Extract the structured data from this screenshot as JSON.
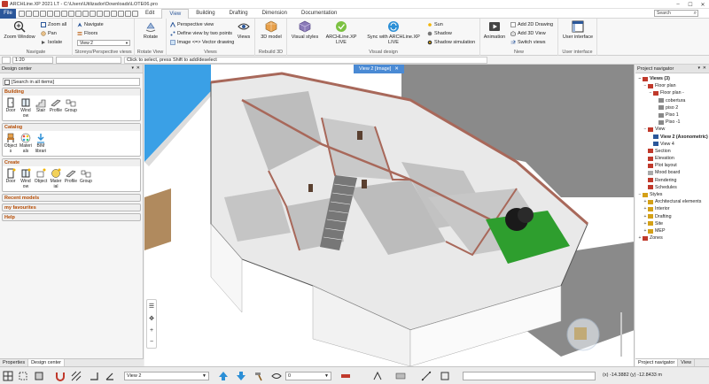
{
  "window": {
    "title": "ARCHLine.XP 2021  LT - C:\\Users\\Utilizador\\Downloads\\LOTE06.pro",
    "controls": [
      "–",
      "☐",
      "✕"
    ]
  },
  "menu": {
    "file": "File",
    "tabs": [
      "Edit",
      "View",
      "Building",
      "Drafting",
      "Dimension",
      "Documentation"
    ],
    "active_tab": "View",
    "search_placeholder": "Search"
  },
  "ribbon": {
    "navigate": {
      "label": "Navigate",
      "zoom_window": "Zoom Window",
      "zoom_all": "Zoom all",
      "pan": "Pan",
      "isolate": "Isolate"
    },
    "storeys": {
      "label": "Storeys/Perspective views",
      "navigate": "Navigate",
      "floors": "Floors",
      "view_select": "View 2"
    },
    "rotate_view": {
      "label": "Rotate View",
      "rotate": "Rotate"
    },
    "views": {
      "label": "Views",
      "perspective_view": "Perspective view",
      "define_view": "Define view by two points",
      "image_vector": "Image <=> Vector drawing",
      "views_btn": "Views"
    },
    "rebuild": {
      "label": "Rebuild 3D",
      "model_3d": "3D model"
    },
    "visual_design": {
      "label": "Visual design",
      "visual_styles": "Visual styles",
      "archline_live": "ARCHLine.XP LIVE",
      "sync_live": "Sync with ARCHLine.XP LIVE",
      "sun": "Sun",
      "shadow": "Shadow",
      "shadow_sim": "Shadow simulation"
    },
    "new": {
      "label": "New",
      "animation": "Animation",
      "add_2d": "Add 2D Drawing",
      "add_3d": "Add 3D View",
      "switch_views": "Switch views"
    },
    "ui": {
      "label": "User interface",
      "user_interface": "User interface"
    }
  },
  "propbar": {
    "scale": "1:20",
    "message": "Click to select, press Shift to add/deselect"
  },
  "design_center": {
    "title": "Design center",
    "search": "[Search in all items]",
    "building": {
      "title": "Building",
      "items": [
        "Door",
        "Wind ow",
        "Stair",
        "Profile",
        "Group"
      ]
    },
    "catalog": {
      "title": "Catalog",
      "items": [
        "Object s",
        "Materi als",
        "BIM librari"
      ]
    },
    "create": {
      "title": "Create",
      "items": [
        "Door",
        "Wind ow",
        "Object",
        "Mater ial",
        "Profile",
        "Group"
      ]
    },
    "collapsed": [
      "Recent models",
      "my favourites",
      "Help"
    ],
    "bottom_tabs": [
      "Properties",
      "Design center"
    ]
  },
  "viewport": {
    "tab": "View 2 [Image]",
    "nav_tools": [
      "☰",
      "✥",
      "+",
      "−"
    ]
  },
  "project_navigator": {
    "title": "Project navigator",
    "tree": [
      {
        "level": 0,
        "toggle": "−",
        "label": "Views (3)",
        "bold": true,
        "color": "#c0392b"
      },
      {
        "level": 1,
        "toggle": "−",
        "label": "Floor plan",
        "bold": false,
        "color": "#c0392b"
      },
      {
        "level": 2,
        "toggle": "−",
        "label": "Floor plan -",
        "bold": false,
        "color": "#c0392b"
      },
      {
        "level": 3,
        "toggle": "",
        "label": "cobertura",
        "bold": false,
        "color": "#888888"
      },
      {
        "level": 3,
        "toggle": "",
        "label": "piso 2",
        "bold": false,
        "color": "#888888"
      },
      {
        "level": 3,
        "toggle": "",
        "label": "Piso 1",
        "bold": false,
        "color": "#888888"
      },
      {
        "level": 3,
        "toggle": "",
        "label": "Piso -1",
        "bold": false,
        "color": "#888888"
      },
      {
        "level": 1,
        "toggle": "−",
        "label": "View",
        "bold": false,
        "color": "#c0392b"
      },
      {
        "level": 2,
        "toggle": "",
        "label": "View 2 (Axonometric)",
        "bold": true,
        "color": "#2b579a"
      },
      {
        "level": 2,
        "toggle": "",
        "label": "View 4",
        "bold": false,
        "color": "#2b579a"
      },
      {
        "level": 1,
        "toggle": "",
        "label": "Section",
        "bold": false,
        "color": "#c0392b"
      },
      {
        "level": 1,
        "toggle": "",
        "label": "Elevation",
        "bold": false,
        "color": "#c0392b"
      },
      {
        "level": 1,
        "toggle": "",
        "label": "Plot layout",
        "bold": false,
        "color": "#c0392b"
      },
      {
        "level": 1,
        "toggle": "",
        "label": "Mood board",
        "bold": false,
        "color": "#aaaaaa"
      },
      {
        "level": 1,
        "toggle": "",
        "label": "Rendering",
        "bold": false,
        "color": "#c0392b"
      },
      {
        "level": 1,
        "toggle": "",
        "label": "Schedules",
        "bold": false,
        "color": "#c0392b"
      },
      {
        "level": 0,
        "toggle": "−",
        "label": "Styles",
        "bold": false,
        "color": "#d4a017"
      },
      {
        "level": 1,
        "toggle": "+",
        "label": "Architectural elements",
        "bold": false,
        "color": "#d4a017"
      },
      {
        "level": 1,
        "toggle": "+",
        "label": "Interior",
        "bold": false,
        "color": "#d4a017"
      },
      {
        "level": 1,
        "toggle": "+",
        "label": "Drafting",
        "bold": false,
        "color": "#d4a017"
      },
      {
        "level": 1,
        "toggle": "+",
        "label": "Site",
        "bold": false,
        "color": "#d4a017"
      },
      {
        "level": 1,
        "toggle": "+",
        "label": "MEP",
        "bold": false,
        "color": "#d4a017"
      },
      {
        "level": 0,
        "toggle": "+",
        "label": "Zones",
        "bold": false,
        "color": "#c0392b"
      }
    ],
    "bottom_tabs": [
      "Project navigator",
      "View"
    ]
  },
  "statusbar": {
    "view_select": "View 2",
    "layer_value": "0",
    "coords": "(x) -14.3882  (y) -12.8433 m"
  },
  "colors": {
    "accent": "#2b579a",
    "catalog_header": "#b54a00",
    "view_tab": "#4a8ad4"
  }
}
